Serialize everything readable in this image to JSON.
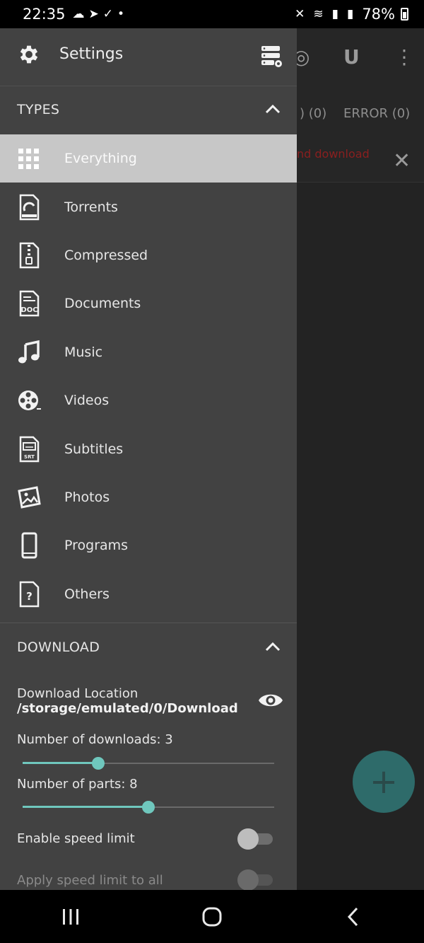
{
  "status_bar": {
    "time": "22:35",
    "battery": "78%"
  },
  "background": {
    "tab_partial": ") (0)",
    "tab_error": "ERROR (0)",
    "banner_text": "nd download"
  },
  "drawer": {
    "title": "Settings",
    "types_section": {
      "label": "TYPES",
      "items": [
        {
          "label": "Everything",
          "icon": "grid-icon",
          "active": true
        },
        {
          "label": "Torrents",
          "icon": "torrent-file-icon"
        },
        {
          "label": "Compressed",
          "icon": "zip-file-icon"
        },
        {
          "label": "Documents",
          "icon": "doc-file-icon"
        },
        {
          "label": "Music",
          "icon": "music-note-icon"
        },
        {
          "label": "Videos",
          "icon": "film-reel-icon"
        },
        {
          "label": "Subtitles",
          "icon": "srt-file-icon"
        },
        {
          "label": "Photos",
          "icon": "photo-icon"
        },
        {
          "label": "Programs",
          "icon": "phone-icon"
        },
        {
          "label": "Others",
          "icon": "question-file-icon"
        }
      ]
    },
    "download_section": {
      "label": "DOWNLOAD",
      "location_title": "Download Location",
      "location_path": "/storage/emulated/0/Download",
      "num_downloads_label": "Number of downloads: 3",
      "num_downloads_value": 3,
      "num_parts_label": "Number of parts: 8",
      "num_parts_value": 8,
      "speed_limit_label": "Enable speed limit",
      "apply_all_label": "Apply speed limit to all"
    }
  },
  "colors": {
    "drawer_bg": "#424242",
    "active_row": "#c7c7c7",
    "accent": "#6fc7bd",
    "fab": "#2e6b6a"
  }
}
